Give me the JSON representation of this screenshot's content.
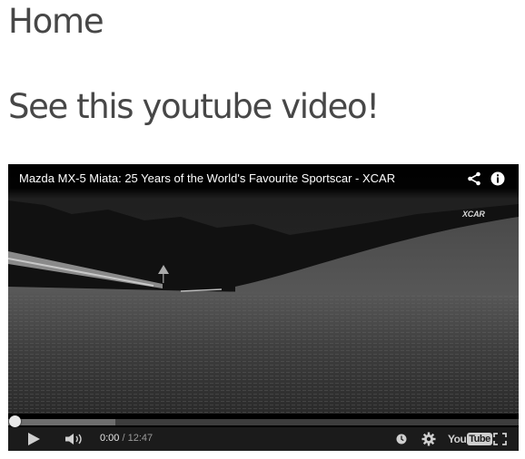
{
  "page": {
    "heading": "Home",
    "subheading": "See this youtube video!"
  },
  "player": {
    "video_title": "Mazda MX-5 Miata: 25 Years of the World's Favourite Sportscar - XCAR",
    "watermark": "XCAR",
    "current_time": "0:00",
    "separator": " / ",
    "duration": "12:47",
    "buffered_fraction": 0.21,
    "played_fraction": 0.0,
    "icons": {
      "share": "share-icon",
      "info": "info-icon",
      "play": "play-icon",
      "volume": "volume-icon",
      "watch_later": "clock-icon",
      "settings": "gear-icon",
      "logo": "youtube-logo",
      "fullscreen": "fullscreen-icon"
    },
    "logo_text": {
      "you": "You",
      "tube": "Tube"
    }
  }
}
